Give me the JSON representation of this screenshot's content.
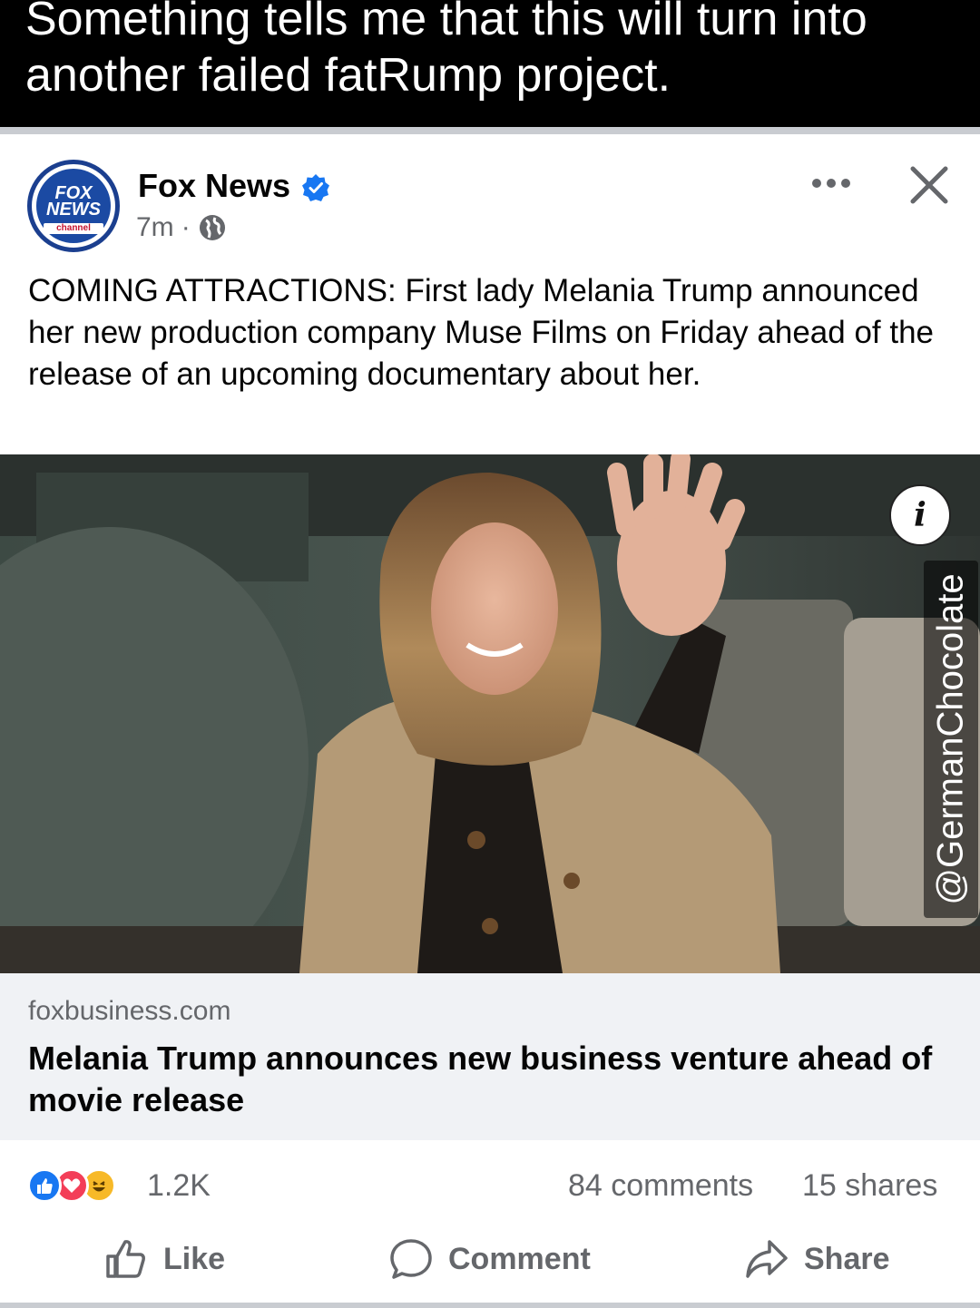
{
  "caption": {
    "text": "Something tells me that this will turn into another failed fatRump project."
  },
  "post": {
    "page_name": "Fox News",
    "time": "7m",
    "dot": "·",
    "logo_text_1": "FOX",
    "logo_text_2": "NEWS",
    "logo_text_3": "channel",
    "text": "COMING ATTRACTIONS: First lady Melania Trump announced her new production company Muse Films on Friday ahead of the release of an upcoming documentary about her.",
    "info_label": "i",
    "watermark": "@GermanChocolate"
  },
  "link": {
    "domain": "foxbusiness.com",
    "title": "Melania Trump announces new business venture ahead of movie release"
  },
  "stats": {
    "reactions": "1.2K",
    "comments": "84 comments",
    "shares": "15 shares"
  },
  "actions": {
    "like": "Like",
    "comment": "Comment",
    "share": "Share"
  },
  "colors": {
    "facebook_blue": "#1877f2",
    "love_red": "#f33e58",
    "haha_yellow": "#f7b928",
    "secondary_text": "#65676b",
    "fox_blue": "#1b4aa3"
  },
  "icons": [
    "verified-badge-icon",
    "globe-icon",
    "more-icon",
    "close-icon",
    "info-icon",
    "like-reaction-icon",
    "love-reaction-icon",
    "haha-reaction-icon",
    "like-icon",
    "comment-icon",
    "share-icon"
  ]
}
